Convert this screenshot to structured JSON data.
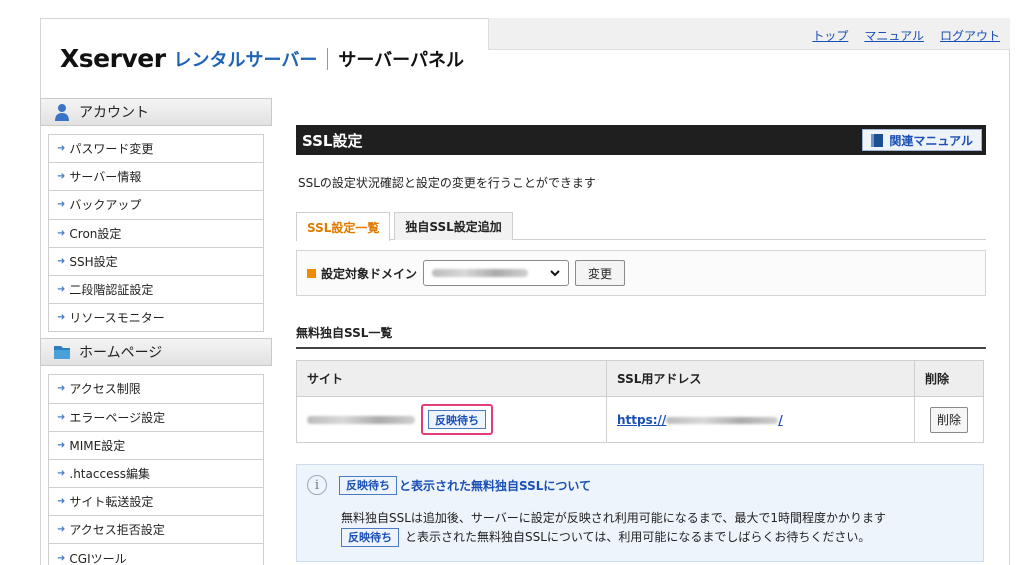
{
  "header": {
    "logo_brand": "Xserver",
    "logo_rental": "レンタルサーバー",
    "logo_panel": "サーバーパネル",
    "nav": [
      "トップ",
      "マニュアル",
      "ログアウト"
    ]
  },
  "sidebar": {
    "account_label": "アカウント",
    "account_items": [
      "パスワード変更",
      "サーバー情報",
      "バックアップ",
      "Cron設定",
      "SSH設定",
      "二段階認証設定",
      "リソースモニター"
    ],
    "homepage_label": "ホームページ",
    "homepage_items": [
      "アクセス制限",
      "エラーページ設定",
      "MIME設定",
      ".htaccess編集",
      "サイト転送設定",
      "アクセス拒否設定",
      "CGIツール"
    ]
  },
  "main": {
    "title": "SSL設定",
    "manual_label": "関連マニュアル",
    "description": "SSLの設定状況確認と設定の変更を行うことができます",
    "tabs": [
      "SSL設定一覧",
      "独自SSL設定追加"
    ],
    "domain_label": "設定対象ドメイン",
    "change_label": "変更",
    "section_title": "無料独自SSL一覧",
    "table": {
      "headers": [
        "サイト",
        "SSL用アドレス",
        "削除"
      ],
      "row": {
        "status": "反映待ち",
        "url_prefix": "https://",
        "url_suffix": "/",
        "delete_label": "削除"
      }
    },
    "info": {
      "badge": "反映待ち",
      "title": "と表示された無料独自SSLについて",
      "line1": "無料独自SSLは追加後、サーバーに設定が反映され利用可能になるまで、最大で1時間程度かかります",
      "line2_badge": "反映待ち",
      "line2": "と表示された無料独自SSLについては、利用可能になるまでしばらくお待ちください。"
    }
  },
  "colors": {
    "accent": "#1a4fb5",
    "highlight": "#e43b7a",
    "tab_active": "#e07a00"
  }
}
